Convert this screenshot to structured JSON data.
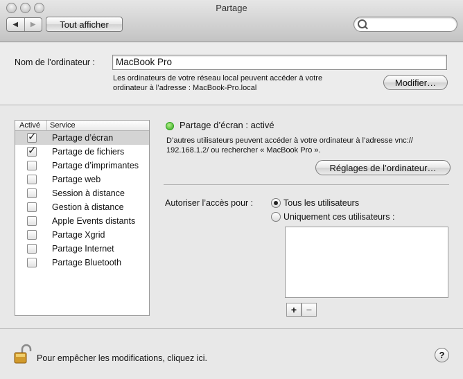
{
  "window": {
    "title": "Partage"
  },
  "toolbar": {
    "back_icon": "◀",
    "forward_icon": "▶",
    "show_all_label": "Tout afficher",
    "search_value": ""
  },
  "computer": {
    "name_label": "Nom de l’ordinateur :",
    "name_value": "MacBook Pro",
    "description_line1": "Les ordinateurs de votre réseau local peuvent accéder à votre",
    "description_line2": "ordinateur à l’adresse : MacBook-Pro.local",
    "edit_button": "Modifier…"
  },
  "services": {
    "header_enabled": "Activé",
    "header_service": "Service",
    "items": [
      {
        "label": "Partage d’écran",
        "checked": true,
        "selected": true
      },
      {
        "label": "Partage de fichiers",
        "checked": true,
        "selected": false
      },
      {
        "label": "Partage d’imprimantes",
        "checked": false,
        "selected": false
      },
      {
        "label": "Partage web",
        "checked": false,
        "selected": false
      },
      {
        "label": "Session à distance",
        "checked": false,
        "selected": false
      },
      {
        "label": "Gestion à distance",
        "checked": false,
        "selected": false
      },
      {
        "label": "Apple Events distants",
        "checked": false,
        "selected": false
      },
      {
        "label": "Partage Xgrid",
        "checked": false,
        "selected": false
      },
      {
        "label": "Partage Internet",
        "checked": false,
        "selected": false
      },
      {
        "label": "Partage Bluetooth",
        "checked": false,
        "selected": false
      }
    ]
  },
  "detail": {
    "status": "Partage d’écran : activé",
    "status_color": "#2ea31c",
    "info_line1": "D’autres utilisateurs peuvent accéder à votre ordinateur à l’adresse vnc://",
    "info_line2": "192.168.1.2/ ou rechercher « MacBook Pro ».",
    "settings_button": "Réglages de l’ordinateur…",
    "access_label": "Autoriser l’accès pour :",
    "option_all": "Tous les utilisateurs",
    "option_only": "Uniquement ces utilisateurs :",
    "selected_option": "all",
    "add_label": "+",
    "remove_label": "−"
  },
  "footer": {
    "lock_text": "Pour empêcher les modifications, cliquez ici.",
    "help_label": "?"
  }
}
